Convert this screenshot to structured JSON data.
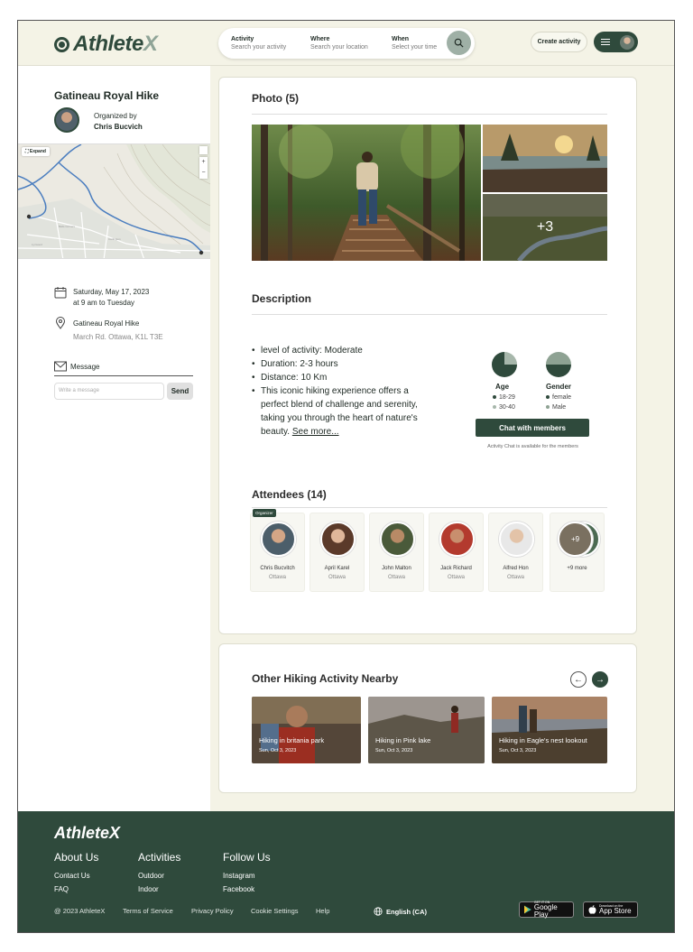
{
  "header": {
    "logo_main": "Athlete",
    "logo_x": "X",
    "search": [
      {
        "label": "Activity",
        "placeholder": "Search your activity"
      },
      {
        "label": "Where",
        "placeholder": "Search your location"
      },
      {
        "label": "When",
        "placeholder": "Select your time"
      }
    ],
    "create_label": "Create activity"
  },
  "event": {
    "title": "Gatineau Royal Hike",
    "organized_by": "Organized by",
    "organizer": "Chris Bucvich",
    "map_expand": "Expand",
    "date": "Saturday, May 17, 2023",
    "time": "at 9 am to Tuesday",
    "place": "Gatineau Royal Hike",
    "address": "March Rd. Ottawa, K1L T3E",
    "message_label": "Message",
    "message_placeholder": "Write a message",
    "send_label": "Send"
  },
  "photos": {
    "title": "Photo (5)",
    "more": "+3"
  },
  "description": {
    "title": "Description",
    "bullets": [
      "level of activity: Moderate",
      "Duration: 2-3 hours",
      "Distance: 10 Km",
      "This iconic hiking experience offers a perfect blend of challenge and serenity, taking you through the heart of nature's beauty."
    ],
    "see_more": "See more..."
  },
  "stats": {
    "age": {
      "title": "Age",
      "items": [
        "18-29",
        "30-40"
      ]
    },
    "gender": {
      "title": "Gender",
      "items": [
        "female",
        "Male"
      ]
    }
  },
  "chat": {
    "button": "Chat with members",
    "note": "Activity Chat is available for the members"
  },
  "attendees": {
    "title": "Attendees (14)",
    "badge": "Organizer",
    "people": [
      {
        "name": "Chris Bucvitch",
        "city": "Ottawa"
      },
      {
        "name": "April Karel",
        "city": "Ottawa"
      },
      {
        "name": "John Malton",
        "city": "Ottawa"
      },
      {
        "name": "Jack Richard",
        "city": "Ottawa"
      },
      {
        "name": "Alfred Hon",
        "city": "Ottawa"
      }
    ],
    "more": "+9 more",
    "more_badge": "+9"
  },
  "nearby": {
    "title": "Other Hiking Activity Nearby",
    "items": [
      {
        "title": "Hiking in britania park",
        "date": "Sun, Oct 3, 2023"
      },
      {
        "title": "Hiking in Pink lake",
        "date": "Sun, Oct 3, 2023"
      },
      {
        "title": "Hiking in Eagle's nest lookout",
        "date": "Sun, Oct 3, 2023"
      }
    ]
  },
  "footer": {
    "logo": "AthleteX",
    "columns": [
      {
        "heading": "About Us",
        "items": [
          "Contact Us",
          "FAQ"
        ]
      },
      {
        "heading": "Activities",
        "items": [
          "Outdoor",
          "Indoor"
        ]
      },
      {
        "heading": "Follow Us",
        "items": [
          "Instagram",
          "Facebook"
        ]
      }
    ],
    "copyright": "@ 2023 AthleteX",
    "links": [
      "Terms of Service",
      "Privacy Policy",
      "Cookie Settings",
      "Help"
    ],
    "language": "English (CA)",
    "google_small": "GET IT ON",
    "google_big": "Google Play",
    "apple_small": "Download on the",
    "apple_big": "App Store"
  },
  "colors": {
    "brand": "#2f4a3c",
    "background": "#f4f3e6",
    "accent": "#9fb0a6"
  }
}
